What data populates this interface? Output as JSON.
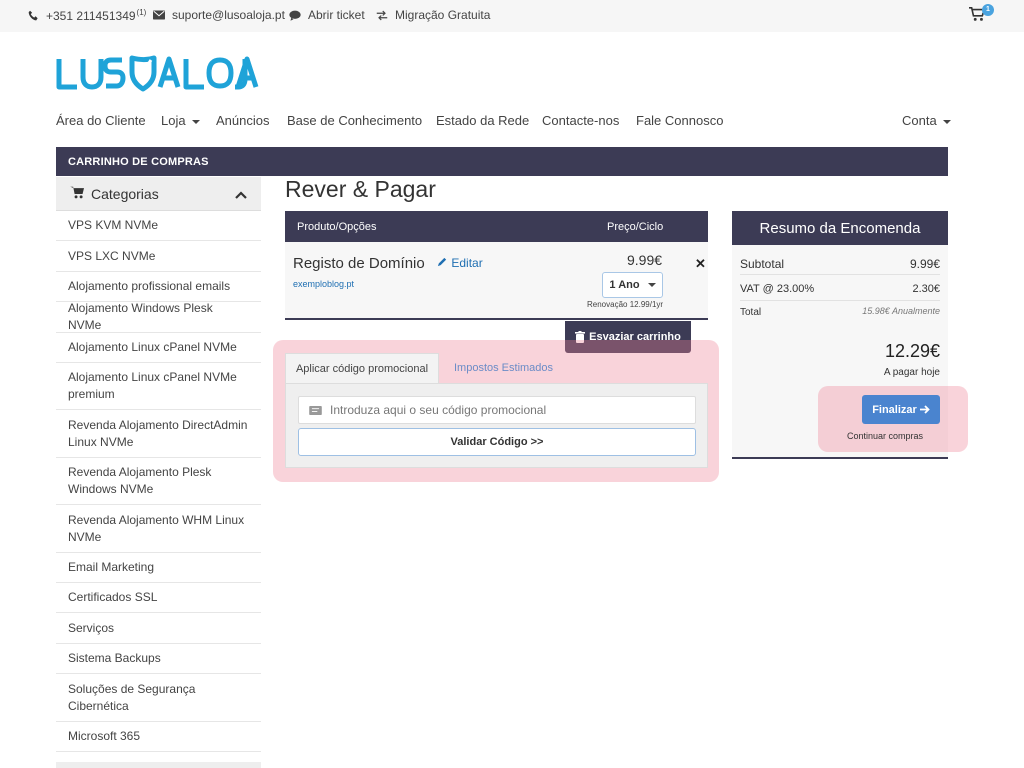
{
  "topbar": {
    "phone": "+351 211451349",
    "phone_sup": "(1)",
    "email": "suporte@lusoaloja.pt",
    "ticket": "Abrir ticket",
    "migration": "Migração Gratuita",
    "cart_count": "1",
    "icons": [
      "phone-icon",
      "envelope-icon",
      "chat-icon",
      "exchange-icon",
      "cart-icon"
    ]
  },
  "logo": {
    "text": "LUSOALOJA",
    "color": "#1fa3d8"
  },
  "nav": {
    "client_area": "Área do Cliente",
    "store": "Loja",
    "announcements": "Anúncios",
    "knowledgebase": "Base de Conhecimento",
    "network_status": "Estado da Rede",
    "contact": "Contacte-nos",
    "talk": "Fale Connosco",
    "account": "Conta"
  },
  "section_bar": "CARRINHO DE COMPRAS",
  "sidebar": {
    "title": "Categorias",
    "items": [
      "VPS KVM NVMe",
      "VPS LXC NVMe",
      "Alojamento profissional emails",
      "Alojamento Windows Plesk NVMe",
      "Alojamento Linux cPanel NVMe",
      "Alojamento Linux cPanel NVMe premium",
      "Revenda Alojamento DirectAdmin Linux NVMe",
      "Revenda Alojamento Plesk Windows NVMe",
      "Revenda Alojamento WHM Linux NVMe",
      "Email Marketing",
      "Certificados SSL",
      "Serviços",
      "Sistema Backups",
      "Soluções de Segurança Cibernética",
      "Microsoft 365"
    ]
  },
  "page_title": "Rever & Pagar",
  "cart": {
    "col_product": "Produto/Opções",
    "col_price": "Preço/Ciclo",
    "item": {
      "name": "Registo de Domínio",
      "edit": "Editar",
      "domain": "exemploblog.pt",
      "price": "9.99€",
      "cycle": "1 Ano",
      "renewal": "Renovação 12.99/1yr"
    },
    "empty_label": "Esvaziar carrinho"
  },
  "promo": {
    "tab_promo": "Aplicar código promocional",
    "tab_tax": "Impostos Estimados",
    "placeholder": "Introduza aqui o seu código promocional",
    "validate": "Validar Código >>"
  },
  "summary": {
    "title": "Resumo da Encomenda",
    "subtotal_label": "Subtotal",
    "subtotal": "9.99€",
    "vat_label": "VAT @ 23.00%",
    "vat": "2.30€",
    "total_label": "Total",
    "total_recurring": "15.98€ Anualmente",
    "total_today": "12.29€",
    "today_label": "A pagar hoje",
    "checkout": "Finalizar",
    "continue": "Continuar compras"
  },
  "colors": {
    "dark": "#3c3b55",
    "accent": "#4a84cf",
    "highlight": "#ee8296"
  }
}
